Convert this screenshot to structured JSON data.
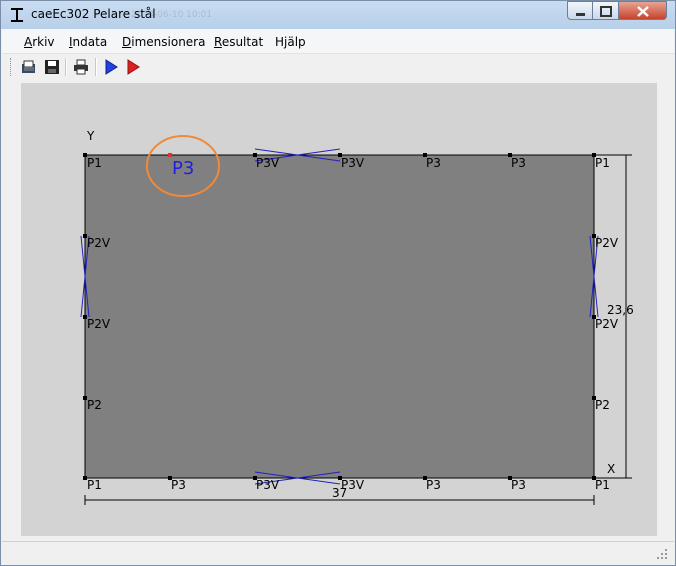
{
  "window": {
    "title": "caeEc302 Pelare stål",
    "ghost_title": "2013-06-10 10:01"
  },
  "menu": [
    {
      "mnemonic": "A",
      "rest": "rkiv"
    },
    {
      "mnemonic": "I",
      "rest": "ndata"
    },
    {
      "mnemonic": "D",
      "rest": "imensionera"
    },
    {
      "mnemonic": "R",
      "rest": "esultat"
    },
    {
      "mnemonic": "",
      "rest": "Hjälp"
    }
  ],
  "toolbar": {
    "open": "open-icon",
    "save": "save-icon",
    "print": "print-icon",
    "prev": "blue-arrow-icon",
    "next": "red-arrow-icon"
  },
  "drawing": {
    "axis_y": "Y",
    "axis_x": "X",
    "width_dim": "37",
    "height_dim": "23,6",
    "highlight": "P3",
    "labels": {
      "top": [
        "P1",
        "P3V",
        "P3V",
        "P3",
        "P3",
        "P1"
      ],
      "bottom": [
        "P1",
        "P3",
        "P3V",
        "P3V",
        "P3",
        "P3",
        "P1"
      ],
      "left": [
        "P2V",
        "P2V",
        "P2"
      ],
      "right": [
        "P2V",
        "P2V",
        "P2"
      ]
    },
    "colors": {
      "plate": "#808080",
      "highlight_ring": "#f08a3a",
      "highlight_text": "#1f1fe0",
      "buckle": "#2020c0"
    }
  }
}
